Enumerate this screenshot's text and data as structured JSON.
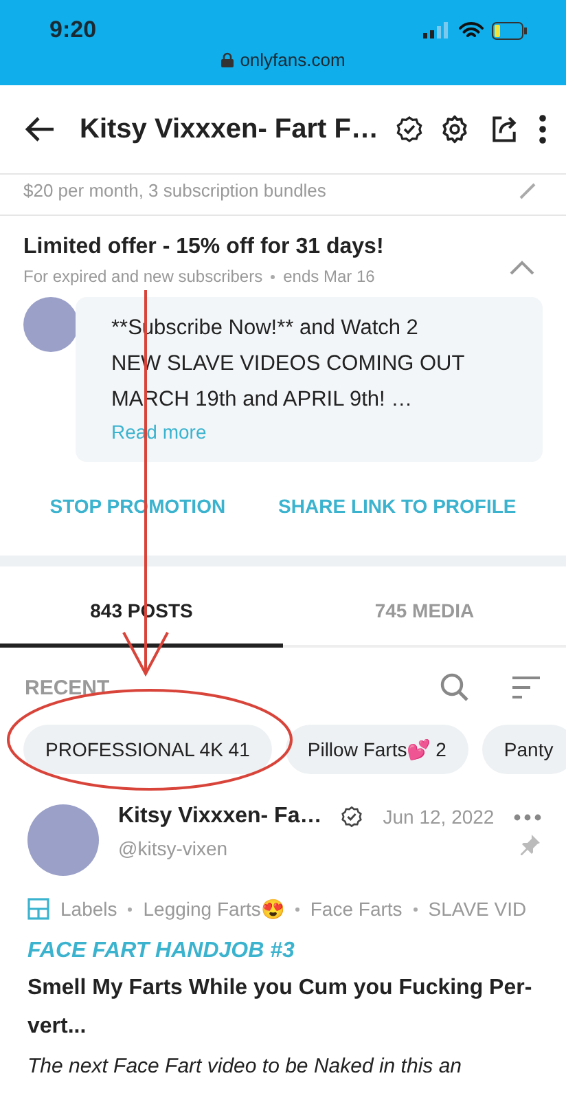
{
  "status_bar": {
    "time": "9:20",
    "url": "onlyfans.com"
  },
  "header": {
    "title": "Kitsy Vixxxen- Fart F…"
  },
  "subscription": {
    "price_text": "$20 per month, 3 subscription bundles"
  },
  "offer": {
    "title": "Limited offer - 15% off for 31 days!",
    "audience": "For expired and new subscribers",
    "ends": "ends Mar 16",
    "expanded": true,
    "message": "**Subscribe Now!** and Watch 2 NEW SLAVE VIDEOS COMING OUT MARCH 19th and APRIL 9th! …",
    "read_more": "Read more",
    "actions": [
      "STOP PROMOTION",
      "SHARE LINK TO PROFILE"
    ]
  },
  "tabs": [
    {
      "label": "843 POSTS",
      "selected": true
    },
    {
      "label": "745 MEDIA",
      "selected": false
    }
  ],
  "filter": {
    "label": "RECENT"
  },
  "chips": [
    {
      "label": "PROFESSIONAL 4K 41"
    },
    {
      "label": "Pillow Farts💕 2"
    },
    {
      "label": "Panty"
    }
  ],
  "post": {
    "author": "Kitsy Vixxxen- Fa…",
    "handle": "@kitsy-vixen",
    "date": "Jun 12, 2022",
    "pinned": true,
    "labels_title": "Labels",
    "labels": [
      "Legging Farts😍",
      "Face Farts",
      "SLAVE VID"
    ],
    "title": "FACE FART HANDJOB #3",
    "headline": "Smell My Farts While you Cum you Fucking Per-vert...",
    "excerpt": "The next Face Fart video to be Naked in this an"
  }
}
